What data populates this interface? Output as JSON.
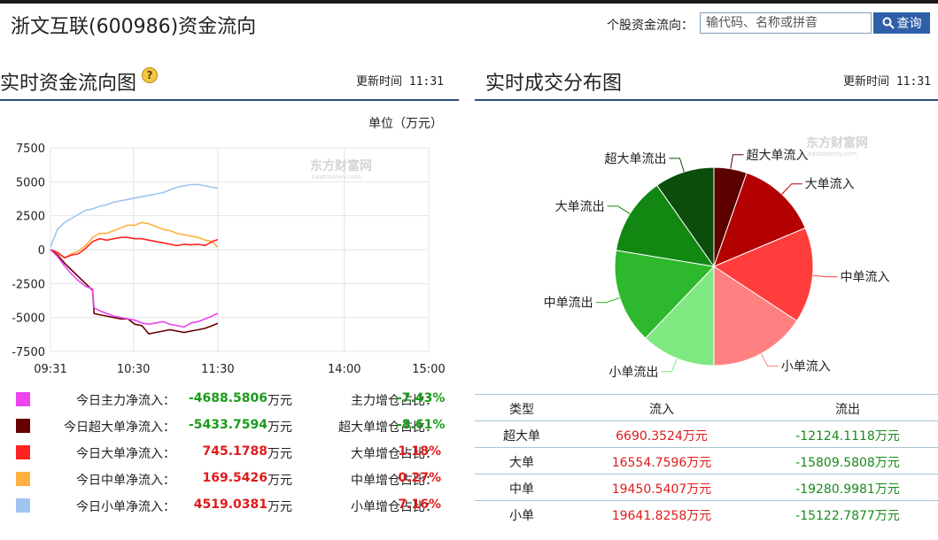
{
  "page": {
    "title": "浙文互联(600986)资金流向",
    "search_label": "个股资金流向：",
    "search_placeholder": "输代码、名称或拼音",
    "search_button": "查询"
  },
  "left": {
    "title": "实时资金流向图",
    "update_label": "更新时间",
    "update_time": "11:31",
    "unit": "单位（万元）",
    "watermark": "东方财富网",
    "watermark_sub": "eastmoney.com"
  },
  "right": {
    "title": "实时成交分布图",
    "update_label": "更新时间",
    "update_time": "11:31",
    "watermark": "东方财富网",
    "watermark_sub": "eastmoney.com"
  },
  "legend": [
    {
      "label": "今日主力净流入：",
      "value": "-4688.5806",
      "unit": "万元",
      "ratio_label": "主力增仓占比：",
      "ratio": "-7.43%",
      "color": "#ee44ee",
      "sign": "neg"
    },
    {
      "label": "今日超大单净流入：",
      "value": "-5433.7594",
      "unit": "万元",
      "ratio_label": "超大单增仓占比：",
      "ratio": "-8.61%",
      "color": "#660000",
      "sign": "neg"
    },
    {
      "label": "今日大单净流入：",
      "value": "745.1788",
      "unit": "万元",
      "ratio_label": "大单增仓占比：",
      "ratio": "1.18%",
      "color": "#ff2222",
      "sign": "pos"
    },
    {
      "label": "今日中单净流入：",
      "value": "169.5426",
      "unit": "万元",
      "ratio_label": "中单增仓占比：",
      "ratio": "0.27%",
      "color": "#ffb040",
      "sign": "pos"
    },
    {
      "label": "今日小单净流入：",
      "value": "4519.0381",
      "unit": "万元",
      "ratio_label": "小单增仓占比：",
      "ratio": "7.16%",
      "color": "#a0c4f0",
      "sign": "pos"
    }
  ],
  "table": {
    "headers": [
      "类型",
      "流入",
      "流出"
    ],
    "rows": [
      {
        "type": "超大单",
        "inflow": "6690.3524万元",
        "outflow": "-12124.1118万元"
      },
      {
        "type": "大单",
        "inflow": "16554.7596万元",
        "outflow": "-15809.5808万元"
      },
      {
        "type": "中单",
        "inflow": "19450.5407万元",
        "outflow": "-19280.9981万元"
      },
      {
        "type": "小单",
        "inflow": "19641.8258万元",
        "outflow": "-15122.7877万元"
      }
    ]
  },
  "chart_data": [
    {
      "type": "line",
      "x_ticks": [
        "09:31",
        "10:30",
        "11:30",
        "14:00",
        "15:00"
      ],
      "x_tick_minutes": [
        0,
        59,
        119,
        209,
        269
      ],
      "ylim": [
        -7500,
        7500
      ],
      "y_ticks": [
        7500,
        5000,
        2500,
        0,
        -2500,
        -5000,
        -7500
      ],
      "grid": true,
      "series": [
        {
          "name": "小单",
          "color": "#a0c4f0",
          "x": [
            0,
            5,
            10,
            15,
            20,
            25,
            30,
            35,
            40,
            45,
            50,
            55,
            60,
            65,
            70,
            75,
            80,
            85,
            90,
            95,
            100,
            105,
            110,
            115,
            119
          ],
          "y": [
            200,
            1500,
            2000,
            2300,
            2600,
            2900,
            3000,
            3200,
            3300,
            3500,
            3600,
            3700,
            3800,
            3900,
            4000,
            4100,
            4200,
            4400,
            4600,
            4700,
            4800,
            4800,
            4700,
            4600,
            4519
          ]
        },
        {
          "name": "中单",
          "color": "#ffb040",
          "x": [
            0,
            5,
            10,
            15,
            20,
            25,
            30,
            35,
            40,
            45,
            50,
            55,
            60,
            65,
            70,
            75,
            80,
            85,
            90,
            95,
            100,
            105,
            110,
            115,
            119
          ],
          "y": [
            0,
            -300,
            -600,
            -300,
            -100,
            300,
            900,
            1200,
            1200,
            1400,
            1600,
            1800,
            1800,
            2000,
            1900,
            1700,
            1500,
            1400,
            1200,
            1100,
            1000,
            900,
            700,
            600,
            170
          ]
        },
        {
          "name": "大单",
          "color": "#ff2222",
          "x": [
            0,
            5,
            10,
            15,
            20,
            25,
            30,
            35,
            40,
            45,
            50,
            55,
            60,
            65,
            70,
            75,
            80,
            85,
            90,
            95,
            100,
            105,
            110,
            115,
            119
          ],
          "y": [
            0,
            -200,
            -600,
            -400,
            -300,
            100,
            600,
            800,
            700,
            800,
            900,
            900,
            800,
            800,
            700,
            600,
            500,
            400,
            300,
            400,
            350,
            400,
            300,
            600,
            745
          ]
        },
        {
          "name": "超大单",
          "color": "#660000",
          "x": [
            0,
            5,
            10,
            15,
            20,
            25,
            30,
            31,
            35,
            40,
            45,
            50,
            55,
            60,
            65,
            70,
            75,
            80,
            85,
            90,
            95,
            100,
            105,
            110,
            115,
            119
          ],
          "y": [
            0,
            -400,
            -1000,
            -1500,
            -2000,
            -2500,
            -3000,
            -4700,
            -4800,
            -4900,
            -5000,
            -5100,
            -5100,
            -5500,
            -5600,
            -6200,
            -6100,
            -6000,
            -5900,
            -6000,
            -6100,
            -6000,
            -5900,
            -5800,
            -5600,
            -5434
          ]
        },
        {
          "name": "主力",
          "color": "#ee44ee",
          "x": [
            0,
            5,
            10,
            15,
            20,
            25,
            30,
            31,
            35,
            40,
            45,
            50,
            55,
            60,
            65,
            70,
            75,
            80,
            85,
            90,
            95,
            100,
            105,
            110,
            115,
            119
          ],
          "y": [
            0,
            -500,
            -1200,
            -1800,
            -2300,
            -2700,
            -2900,
            -4300,
            -4500,
            -4700,
            -4900,
            -5000,
            -5100,
            -5200,
            -5400,
            -5500,
            -5400,
            -5300,
            -5500,
            -5600,
            -5700,
            -5400,
            -5300,
            -5100,
            -4900,
            -4689
          ]
        }
      ]
    },
    {
      "type": "pie",
      "slices": [
        {
          "label": "超大单流入",
          "value": 6690.3524,
          "color": "#5c0000"
        },
        {
          "label": "大单流入",
          "value": 16554.7596,
          "color": "#b30000"
        },
        {
          "label": "中单流入",
          "value": 19450.5407,
          "color": "#ff3d3d"
        },
        {
          "label": "小单流入",
          "value": 19641.8258,
          "color": "#ff8080"
        },
        {
          "label": "小单流出",
          "value": 15122.7877,
          "color": "#80e880"
        },
        {
          "label": "中单流出",
          "value": 19280.9981,
          "color": "#2db82d"
        },
        {
          "label": "大单流出",
          "value": 15809.5808,
          "color": "#128712"
        },
        {
          "label": "超大单流出",
          "value": 12124.1118,
          "color": "#0b4d0b"
        }
      ]
    }
  ]
}
